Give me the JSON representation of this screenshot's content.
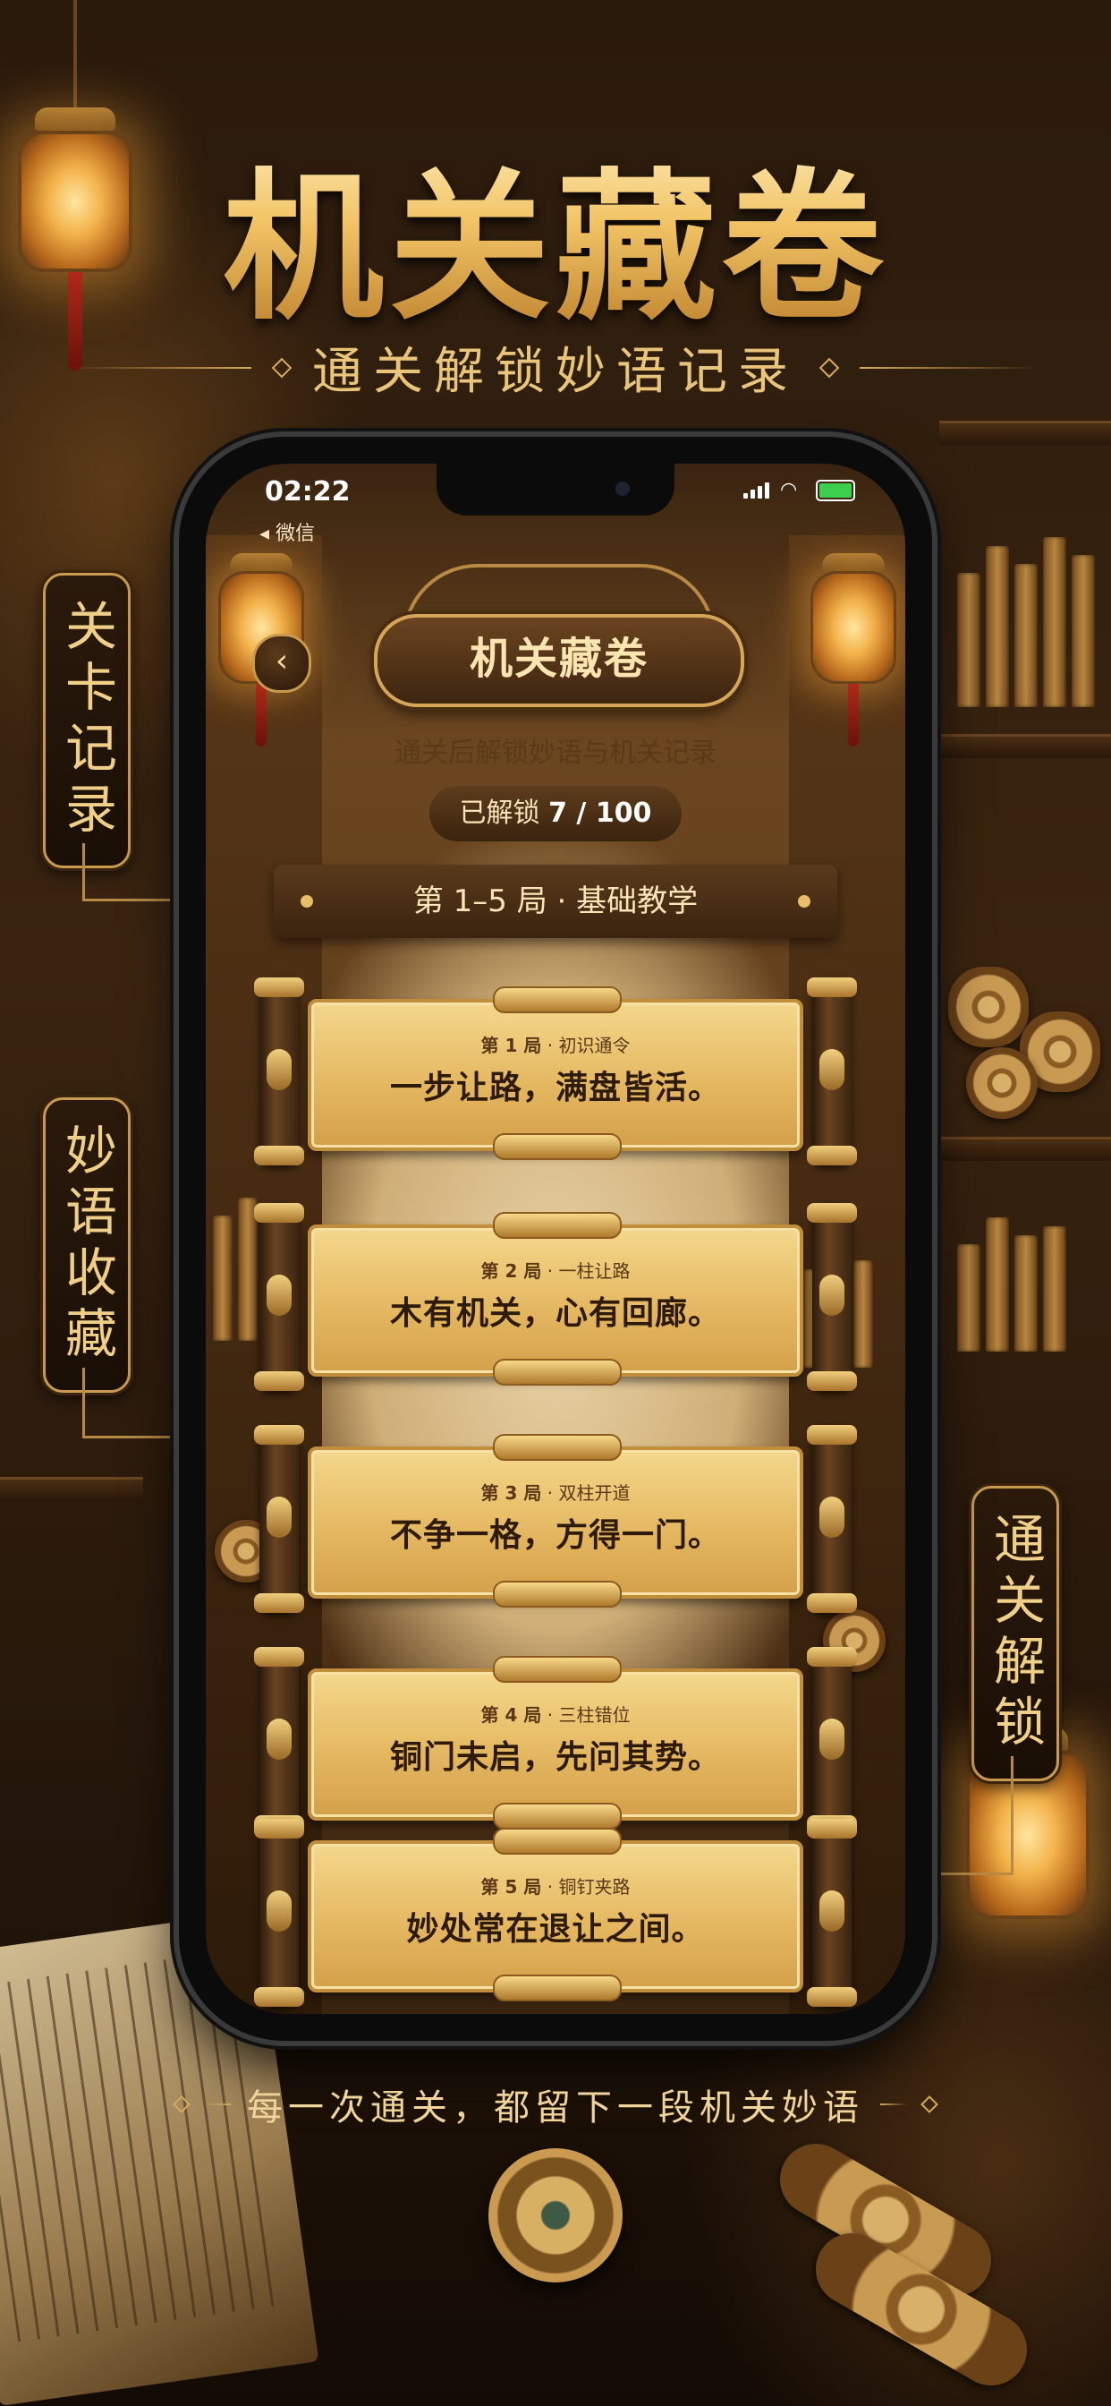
{
  "poster": {
    "title": "机关藏卷",
    "subtitle": "通关解锁妙语记录",
    "footer": "每一次通关，都留下一段机关妙语"
  },
  "side_tags": {
    "left_top": "关卡记录",
    "left_mid": "妙语收藏",
    "right": "通关解锁"
  },
  "phone": {
    "status": {
      "time": "02:22",
      "back_app": "◂ 微信",
      "battery_color": "#3ccf4e"
    },
    "header": {
      "title": "机关藏卷",
      "description": "通关后解锁妙语与机关记录",
      "unlock_label": "已解锁",
      "unlock_count": "7 / 100"
    },
    "section": {
      "title": "第 1–5 局 · 基础教学"
    },
    "levels": [
      {
        "level": "第 1 局",
        "name": "· 初识通令",
        "quote": "一步让路，满盘皆活。"
      },
      {
        "level": "第 2 局",
        "name": "· 一柱让路",
        "quote": "木有机关，心有回廊。"
      },
      {
        "level": "第 3 局",
        "name": "· 双柱开道",
        "quote": "不争一格，方得一门。"
      },
      {
        "level": "第 4 局",
        "name": "· 三柱错位",
        "quote": "铜门未启，先问其势。"
      },
      {
        "level": "第 5 局",
        "name": "· 铜钉夹路",
        "quote": "妙处常在退让之间。"
      }
    ]
  },
  "colors": {
    "gold": "#f2c466",
    "dark_wood": "#3a2410",
    "parchment": "#e5b862"
  },
  "icons": {
    "back": "chevron-left-icon",
    "wifi": "wifi-icon",
    "signal": "signal-icon",
    "battery": "battery-icon"
  }
}
